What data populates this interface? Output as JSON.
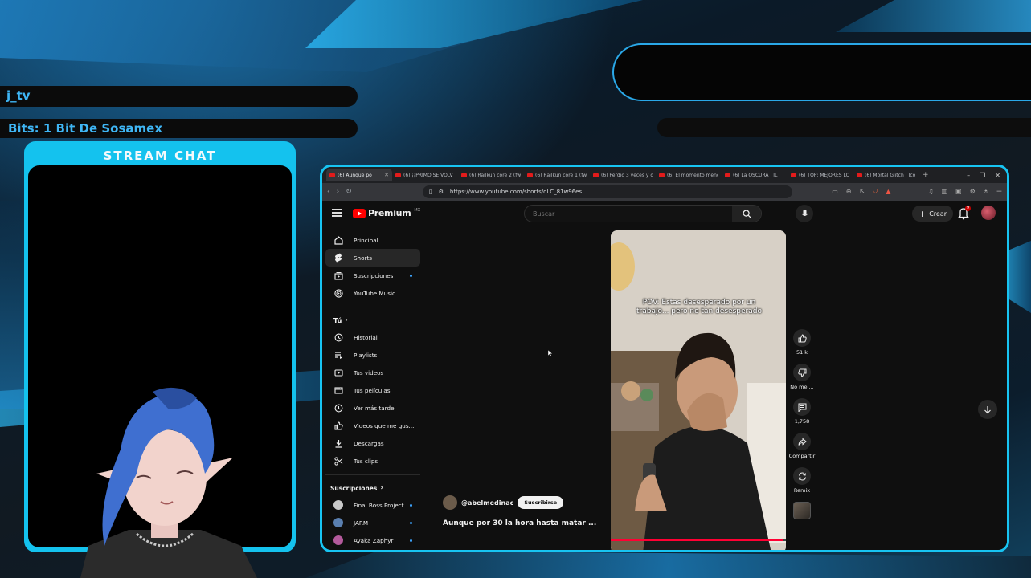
{
  "overlay": {
    "streamer_name": "j_tv",
    "bits_text": "Bits: 1 Bit De Sosamex",
    "chat_title": "STREAM CHAT"
  },
  "browser": {
    "tabs": [
      {
        "label": "(6) Aunque po",
        "active": true
      },
      {
        "label": "(6) ¡¡PRIMO SE VOLV",
        "active": false
      },
      {
        "label": "(6) Railkun core 2 (fwe",
        "active": false
      },
      {
        "label": "(6) Railkun core 1 (fwe",
        "active": false
      },
      {
        "label": "(6) Perdió 3 veces y o",
        "active": false
      },
      {
        "label": "(6) El momento menc",
        "active": false
      },
      {
        "label": "(6) La OSCURA | IL",
        "active": false
      },
      {
        "label": "(6) TOP: MEJORES LO",
        "active": false
      },
      {
        "label": "(6) Mortal Glitch | Ico",
        "active": false
      }
    ],
    "url": "https://www.youtube.com/shorts/oLC_81w96es"
  },
  "youtube": {
    "logo_text": "Premium",
    "region": "MX",
    "search_placeholder": "Buscar",
    "create_label": "Crear",
    "notification_count": "9",
    "sidebar_main": [
      {
        "label": "Principal",
        "icon": "home-icon",
        "active": false,
        "dot": false
      },
      {
        "label": "Shorts",
        "icon": "shorts-icon",
        "active": true,
        "dot": false
      },
      {
        "label": "Suscripciones",
        "icon": "subscriptions-icon",
        "active": false,
        "dot": true
      },
      {
        "label": "YouTube Music",
        "icon": "music-icon",
        "active": false,
        "dot": false
      }
    ],
    "you_section_title": "Tú",
    "sidebar_you": [
      {
        "label": "Historial",
        "icon": "history-icon"
      },
      {
        "label": "Playlists",
        "icon": "playlist-icon"
      },
      {
        "label": "Tus videos",
        "icon": "video-icon"
      },
      {
        "label": "Tus películas",
        "icon": "movie-icon"
      },
      {
        "label": "Ver más tarde",
        "icon": "clock-icon"
      },
      {
        "label": "Videos que me gus...",
        "icon": "like-icon"
      },
      {
        "label": "Descargas",
        "icon": "download-icon"
      },
      {
        "label": "Tus clips",
        "icon": "scissors-icon"
      }
    ],
    "subs_section_title": "Suscripciones",
    "subscriptions": [
      {
        "label": "Final Boss Project",
        "color": "#c9c9c9"
      },
      {
        "label": "JARM",
        "color": "#5a7fb0"
      },
      {
        "label": "Ayaka Zaphyr",
        "color": "#b45a9c"
      }
    ],
    "short": {
      "caption": "POV: Estas desesperado por un trabajo... pero no tan desesperado",
      "channel": "@abelmedinac",
      "subscribe_label": "Suscribirse",
      "title": "Aunque por 30 la hora hasta matar ...",
      "progress": 0.98
    },
    "actions": {
      "like_count": "51 k",
      "dislike_label": "No me ...",
      "comments_count": "1,758",
      "share_label": "Compartir",
      "remix_label": "Remix"
    }
  },
  "colors": {
    "accent": "#17c4f2",
    "chat_frame": "#14c2ee",
    "youtube_red": "#ff0000",
    "overlay_text": "#3fb6f5"
  }
}
